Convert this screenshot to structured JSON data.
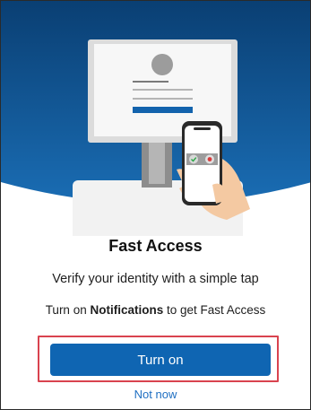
{
  "screen": {
    "title": "Fast Access",
    "subtitle": "Verify your identity with a simple tap",
    "notice": {
      "prefix": "Turn on ",
      "emphasis": "Notifications",
      "suffix": " to get Fast Access"
    },
    "primary_button_label": "Turn on",
    "secondary_link_label": "Not now"
  },
  "colors": {
    "hero_top": "#0a3f73",
    "hero_bottom": "#1a6db4",
    "button": "#0f65b2",
    "link": "#1f6fc2",
    "highlight_border": "#d9434f"
  },
  "icons": [
    "monitor-illustration",
    "avatar-icon",
    "phone-illustration",
    "check-icon",
    "cancel-icon",
    "hand-illustration"
  ]
}
